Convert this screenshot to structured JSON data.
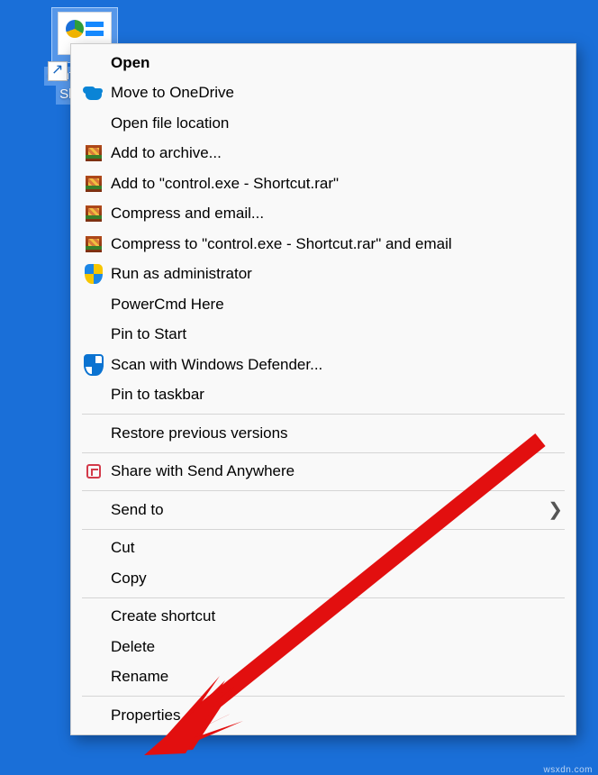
{
  "desktop_icon": {
    "line1": "control.exe -",
    "line2": "Shortcut"
  },
  "menu": {
    "open": "Open",
    "move_onedrive": "Move to OneDrive",
    "open_location": "Open file location",
    "add_archive": "Add to archive...",
    "add_to_rar": "Add to \"control.exe - Shortcut.rar\"",
    "compress_email": "Compress and email...",
    "compress_to_email": "Compress to \"control.exe - Shortcut.rar\" and email",
    "run_admin": "Run as administrator",
    "powercmd": "PowerCmd Here",
    "pin_start": "Pin to Start",
    "scan_defender": "Scan with Windows Defender...",
    "pin_taskbar": "Pin to taskbar",
    "restore_prev": "Restore previous versions",
    "share_sendanywhere": "Share with Send Anywhere",
    "send_to": "Send to",
    "cut": "Cut",
    "copy": "Copy",
    "create_shortcut": "Create shortcut",
    "delete": "Delete",
    "rename": "Rename",
    "properties": "Properties"
  },
  "watermark": "wsxdn.com"
}
